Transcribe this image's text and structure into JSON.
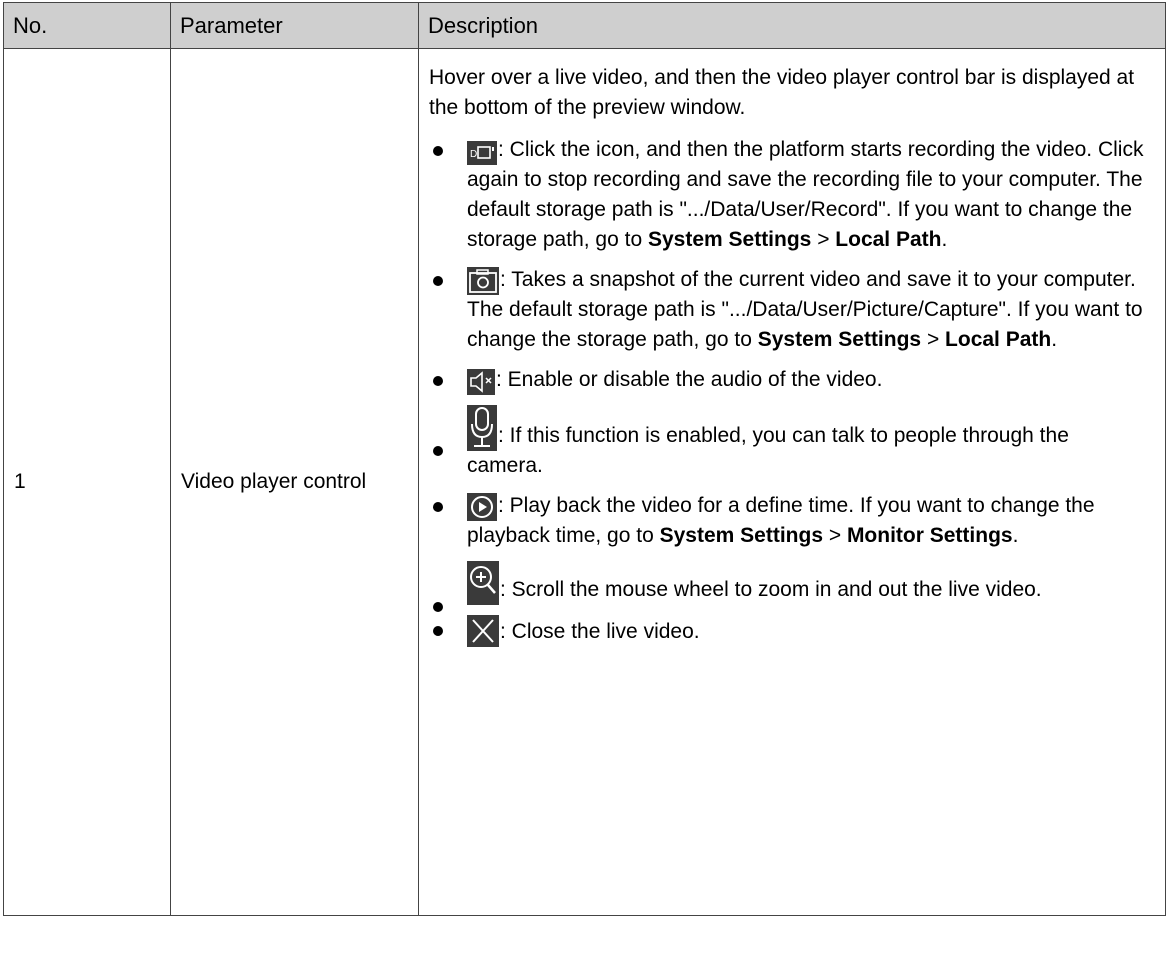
{
  "table": {
    "headers": [
      "No.",
      "Parameter",
      "Description"
    ],
    "row": {
      "no": "1",
      "parameter": "Video player control",
      "intro": "Hover over a live video, and then the video player control bar is displayed at the bottom of the preview window.",
      "items": [
        {
          "icon": "record-icon",
          "pre": ": Click the icon, and then the platform starts recording the video. Click again to stop recording and save the recording file to your computer. The default storage path is \".../Data/User/Record\". If you want to change the storage path, go to ",
          "bold1": "System Settings",
          "sep": " > ",
          "bold2": "Local Path",
          "post": "."
        },
        {
          "icon": "camera-icon",
          "pre": ": Takes a snapshot of the current video and save it to your computer. The default storage path is \".../Data/User/Picture/Capture\". If you want to change the storage path, go to ",
          "bold1": "System Settings",
          "sep": " > ",
          "bold2": "Local Path",
          "post": "."
        },
        {
          "icon": "speaker-mute-icon",
          "text": ": Enable or disable the audio of the video."
        },
        {
          "icon": "microphone-icon",
          "text": ": If this function is enabled, you can talk to people through the camera."
        },
        {
          "icon": "playback-icon",
          "pre": ": Play back the video for a define time. If you want to change the playback time, go to ",
          "bold1": "System Settings",
          "sep": " > ",
          "bold2": "Monitor Settings",
          "post": "."
        },
        {
          "icon": "zoom-in-icon",
          "text": ": Scroll the mouse wheel to zoom in and out the live video."
        },
        {
          "icon": "close-icon",
          "text": ": Close the live video."
        }
      ]
    }
  },
  "colors": {
    "header_bg": "#cfcfcf",
    "border": "#444444",
    "icon_bg": "#3a3a3a"
  }
}
